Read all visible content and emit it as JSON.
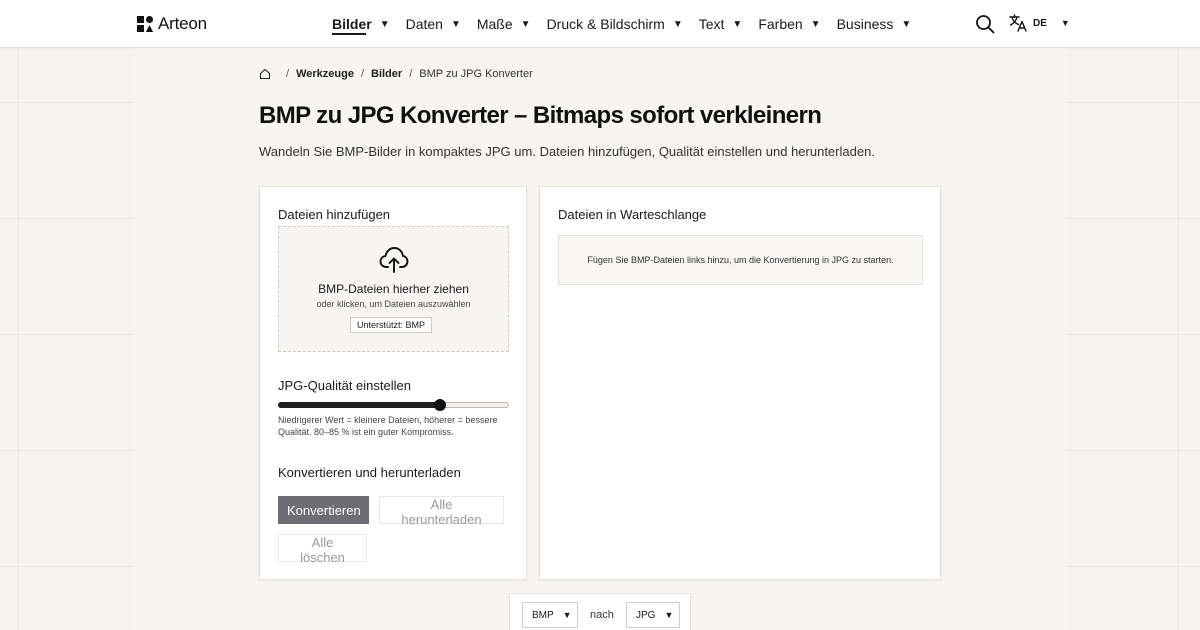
{
  "brand": {
    "name": "Arteon"
  },
  "nav": {
    "items": [
      {
        "label": "Bilder",
        "active": true
      },
      {
        "label": "Daten"
      },
      {
        "label": "Maße"
      },
      {
        "label": "Druck & Bildschirm"
      },
      {
        "label": "Text"
      },
      {
        "label": "Farben"
      },
      {
        "label": "Business"
      }
    ],
    "language": "DE"
  },
  "breadcrumb": {
    "items": [
      "Werkzeuge",
      "Bilder",
      "BMP zu JPG Konverter"
    ]
  },
  "page": {
    "title": "BMP zu JPG Konverter – Bitmaps sofort verkleinern",
    "subtitle": "Wandeln Sie BMP-Bilder in kompaktes JPG um. Dateien hinzufügen, Qualität einstellen und herunterladen."
  },
  "upload": {
    "heading": "Dateien hinzufügen",
    "drop_title": "BMP-Dateien hierher ziehen",
    "drop_sub": "oder klicken, um Dateien auszuwählen",
    "supported": "Unterstützt: BMP"
  },
  "quality": {
    "heading": "JPG-Qualität einstellen",
    "value_percent": 70,
    "hint": "Niedrigerer Wert = kleinere Dateien, höherer = bessere Qualität. 80–85 % ist ein guter Kompromiss."
  },
  "actions": {
    "heading": "Konvertieren und herunterladen",
    "convert": "Konvertieren",
    "download_all": "Alle herunterladen",
    "clear_all": "Alle löschen"
  },
  "queue": {
    "heading": "Dateien in Warteschlange",
    "empty": "Fügen Sie BMP-Dateien links hinzu, um die Konvertierung in JPG zu starten."
  },
  "converter": {
    "from": "BMP",
    "connector": "nach",
    "to": "JPG"
  },
  "colors": {
    "primary_button": "#6e6e72",
    "background": "#f6f3ef"
  }
}
